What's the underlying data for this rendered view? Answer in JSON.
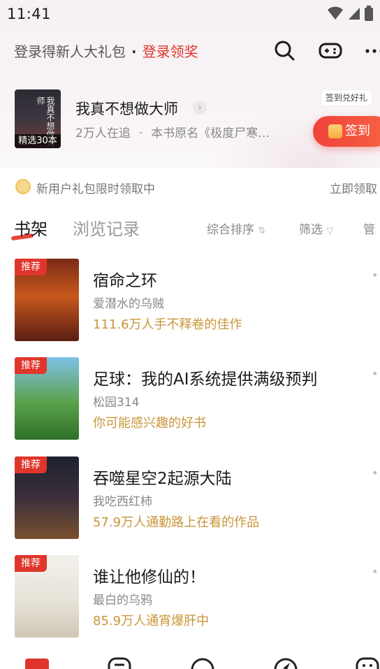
{
  "status_bar": {
    "time": "11:41"
  },
  "header": {
    "promo_text": "登录得新人大礼包",
    "promo_dot": "·",
    "login_link": "登录领奖"
  },
  "recommended": {
    "cover_tag": "精选30本",
    "cover_title": "我真不想做大师",
    "title": "我真不想做大师",
    "chevron": "›",
    "followers": "2万人在追",
    "separator": "·",
    "original_name": "本书原名《极度尸寒…",
    "signin_hint": "签到兑好礼",
    "signin_label": "签到"
  },
  "notice": {
    "text": "新用户礼包限时领取中",
    "action": "立即领取"
  },
  "tabs": {
    "shelf": "书架",
    "history": "浏览记录",
    "sort": "综合排序",
    "sort_icon": "⇅",
    "filter": "筛选",
    "filter_icon": "▽",
    "manage": "管"
  },
  "books": [
    {
      "badge": "推荐",
      "title": "宿命之环",
      "author": "爱潜水的乌贼",
      "desc": "111.6万人手不释卷的佳作"
    },
    {
      "badge": "推荐",
      "title": "足球：我的AI系统提供满级预判",
      "author": "松园314",
      "desc": "你可能感兴趣的好书"
    },
    {
      "badge": "推荐",
      "title": "吞噬星空2起源大陆",
      "author": "我吃西红柿",
      "desc": "57.9万人通勤路上在看的作品"
    },
    {
      "badge": "推荐",
      "title": "谁让他修仙的！",
      "author": "最白的乌鸦",
      "desc": "85.9万人通宵爆肝中"
    }
  ],
  "icons": {
    "search": "search-icon",
    "game": "gamepad-icon",
    "more": "more-icon"
  },
  "colors": {
    "accent": "#e0352b",
    "gold_text": "#c9963a"
  }
}
